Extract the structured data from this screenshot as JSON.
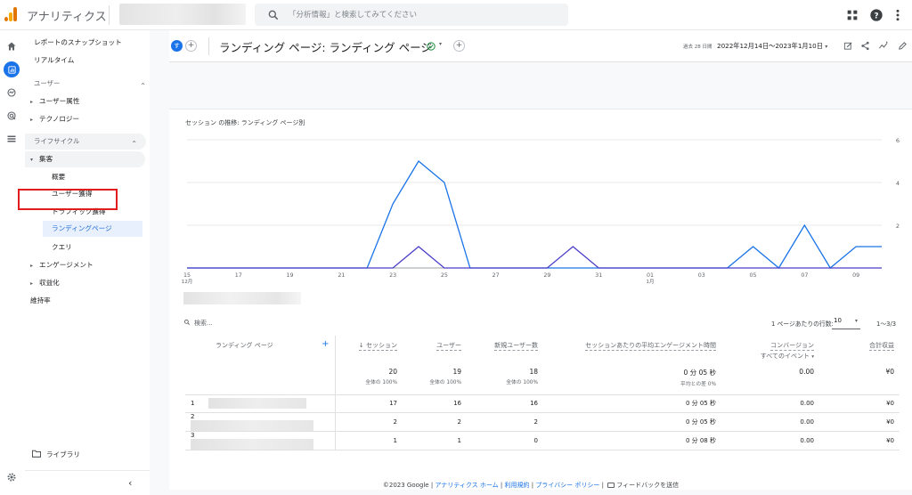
{
  "app": {
    "title": "アナリティクス"
  },
  "search": {
    "placeholder": "「分析情報」と検索してみてください"
  },
  "nav": {
    "snapshot": "レポートのスナップショット",
    "realtime": "リアルタイム",
    "user_section": "ユーザー",
    "user_attr": "ユーザー属性",
    "technology": "テクノロジー",
    "lifecycle_section": "ライフサイクル",
    "acquisition": "集客",
    "overview": "概要",
    "user_acq": "ユーザー獲得",
    "traffic_acq": "トラフィック獲得",
    "landing_page": "ランディングページ",
    "query": "クエリ",
    "engagement": "エンゲージメント",
    "monetization": "収益化",
    "retention": "維持率",
    "library": "ライブラリ"
  },
  "header": {
    "avatar_letter": "す",
    "title": "ランディング ページ: ランディング ページ",
    "date_label": "過去 28 日間",
    "date_range": "2022年12月14日～2023年1月10日"
  },
  "card": {
    "chart_title": "セッション の推移: ランディング ページ別"
  },
  "chart_data": {
    "type": "line",
    "title": "セッション の推移: ランディング ページ別",
    "x_ticks": [
      "15\n12月",
      "17",
      "19",
      "21",
      "23",
      "25",
      "27",
      "29",
      "31",
      "01\n1月",
      "03",
      "05",
      "07",
      "09"
    ],
    "y_ticks": [
      0,
      2,
      4,
      6
    ],
    "ylim": [
      0,
      6
    ],
    "series": [
      {
        "color": "#1a73e8",
        "values": [
          0,
          0,
          0,
          0,
          0,
          0,
          0,
          0,
          3,
          5,
          4,
          0,
          0,
          0,
          0,
          0,
          0,
          0,
          0,
          0,
          0,
          0,
          1,
          0,
          2,
          0,
          1,
          1
        ]
      },
      {
        "color": "#4b3fc8",
        "values": [
          0,
          0,
          0,
          0,
          0,
          0,
          0,
          0,
          0,
          1,
          0,
          0,
          0,
          0,
          0,
          1,
          0,
          0,
          0,
          0,
          0,
          0,
          0,
          0,
          0,
          0,
          0,
          0
        ]
      }
    ]
  },
  "table": {
    "search_placeholder": "検索...",
    "per_page_label": "1 ページあたりの行数:",
    "per_page_value": "10",
    "pager": "1〜3/3",
    "dim_header": "ランディング ページ",
    "headers": {
      "sessions": "↓ セッション",
      "users": "ユーザー",
      "new_users": "新規ユーザー数",
      "engagement": "セッションあたりの平均エンゲージメント時間",
      "conversions": "コンバージョン",
      "conversions_sub": "すべてのイベント",
      "revenue": "合計収益"
    },
    "totals": {
      "sessions": "20",
      "sessions_sub": "全体の 100%",
      "users": "19",
      "users_sub": "全体の 100%",
      "new_users": "18",
      "new_users_sub": "全体の 100%",
      "engagement": "0 分 05 秒",
      "engagement_sub": "平均との差 0%",
      "conversions": "0.00",
      "revenue": "¥0"
    },
    "rows": [
      {
        "index": "1",
        "sessions": "17",
        "users": "16",
        "new_users": "16",
        "engagement": "0 分 05 秒",
        "conversions": "0.00",
        "revenue": "¥0"
      },
      {
        "index": "2",
        "sessions": "2",
        "users": "2",
        "new_users": "2",
        "engagement": "0 分 05 秒",
        "conversions": "0.00",
        "revenue": "¥0"
      },
      {
        "index": "3",
        "sessions": "1",
        "users": "1",
        "new_users": "0",
        "engagement": "0 分 08 秒",
        "conversions": "0.00",
        "revenue": "¥0"
      }
    ]
  },
  "footer": {
    "copyright": "©2023 Google |",
    "home": "アナリティクス ホーム",
    "terms": "利用規約",
    "privacy": "プライバシー ポリシー",
    "feedback": "フィードバックを送信"
  }
}
